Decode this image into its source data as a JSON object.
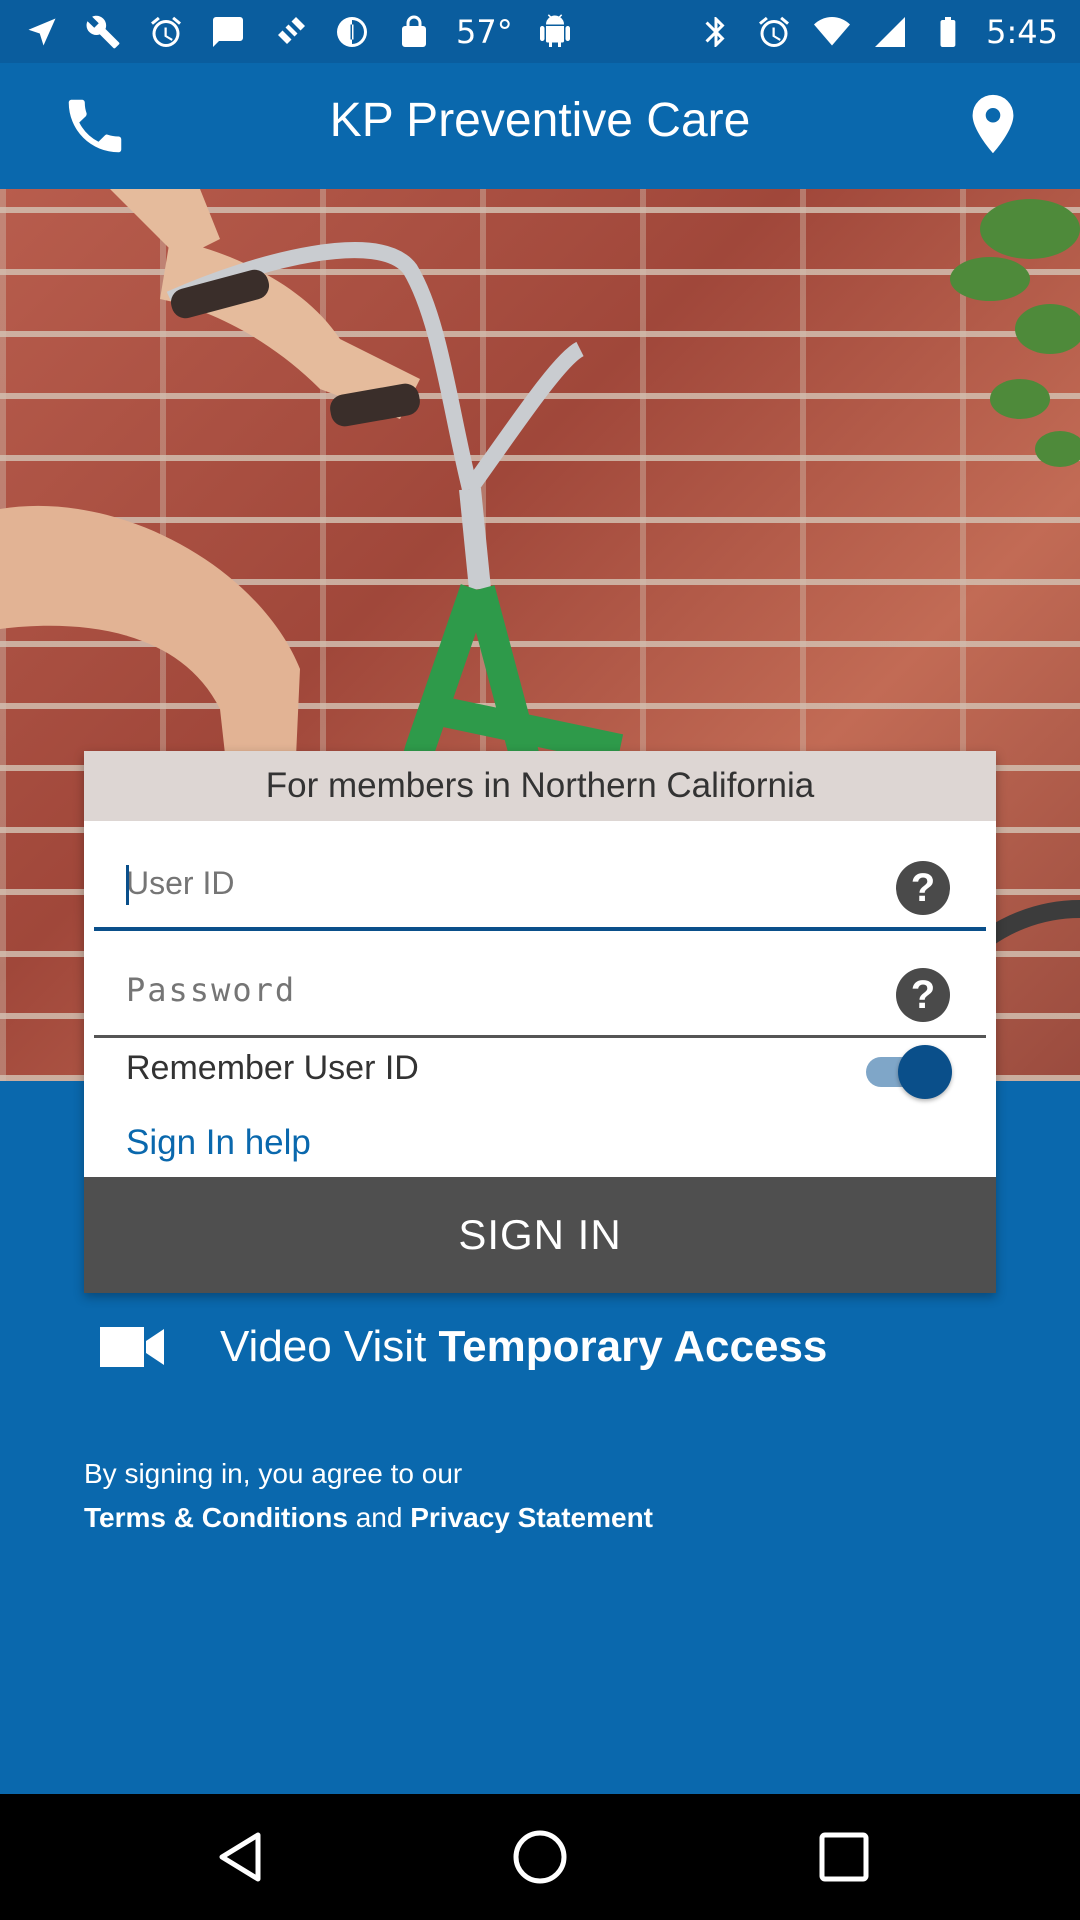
{
  "status_bar": {
    "temperature": "57°",
    "time": "5:45",
    "left_icons": [
      "navigation-icon",
      "wrench-icon",
      "alarm-icon",
      "message-icon",
      "fake-gps-icon",
      "data-saver-icon",
      "lock-icon",
      "temperature",
      "android-icon"
    ],
    "right_icons": [
      "bluetooth-icon",
      "alarm-icon",
      "wifi-icon",
      "signal-icon",
      "battery-icon"
    ]
  },
  "app_bar": {
    "title": "KP Preventive Care",
    "left_icon": "phone-icon",
    "right_icon": "location-pin-icon"
  },
  "login": {
    "region_header": "For members in Northern California",
    "user_id_placeholder": "User ID",
    "password_placeholder": "Password",
    "remember_label": "Remember User ID",
    "remember_on": true,
    "help_link": "Sign In help",
    "signin_label": "SIGN IN"
  },
  "video_visit": {
    "label_plain": "Video Visit ",
    "label_bold": "Temporary Access"
  },
  "legal": {
    "line1": "By signing in, you agree to our",
    "terms": "Terms & Conditions",
    "and": " and ",
    "privacy": "Privacy Statement"
  },
  "colors": {
    "primary": "#0a68ad",
    "status_bar": "#0a5d9e",
    "button": "#4f4f4f",
    "toggle": "#0a4f8a"
  }
}
